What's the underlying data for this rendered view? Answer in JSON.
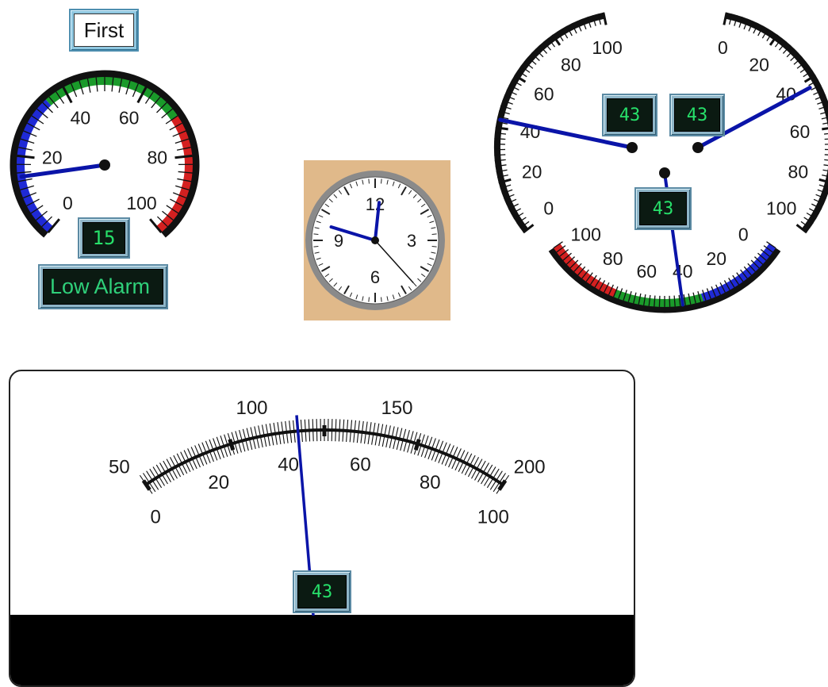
{
  "first_button": {
    "label": "First"
  },
  "gauge_small": {
    "labels": [
      "0",
      "20",
      "40",
      "60",
      "80",
      "100"
    ],
    "readout": "15",
    "alarm": "Low Alarm",
    "value": 15,
    "range": [
      0,
      100
    ],
    "bands": [
      {
        "from": 0,
        "to": 35,
        "color": "#1f2ad6"
      },
      {
        "from": 35,
        "to": 70,
        "color": "#1a9a2a"
      },
      {
        "from": 70,
        "to": 100,
        "color": "#d42020"
      }
    ]
  },
  "clock": {
    "labels": [
      "12",
      "3",
      "6",
      "9"
    ],
    "hour": 11,
    "minute": 59,
    "second": 23
  },
  "tri_gauge": {
    "left": {
      "labels": [
        "0",
        "20",
        "40",
        "60",
        "80",
        "100"
      ],
      "readout": "43",
      "value": 43
    },
    "right": {
      "labels": [
        "0",
        "20",
        "40",
        "60",
        "80",
        "100"
      ],
      "readout": "43",
      "value": 43
    },
    "bottom": {
      "labels": [
        "100",
        "80",
        "60",
        "40",
        "20",
        "0"
      ],
      "readout": "43",
      "value": 43,
      "bands": [
        {
          "from": 0,
          "to": 35,
          "color": "#1f2ad6"
        },
        {
          "from": 35,
          "to": 70,
          "color": "#1a9a2a"
        },
        {
          "from": 70,
          "to": 100,
          "color": "#d42020"
        }
      ]
    }
  },
  "meter": {
    "outer_labels": [
      "50",
      "100",
      "150",
      "200"
    ],
    "inner_labels": [
      "0",
      "20",
      "40",
      "60",
      "80",
      "100"
    ],
    "readout": "43",
    "value": 43
  }
}
